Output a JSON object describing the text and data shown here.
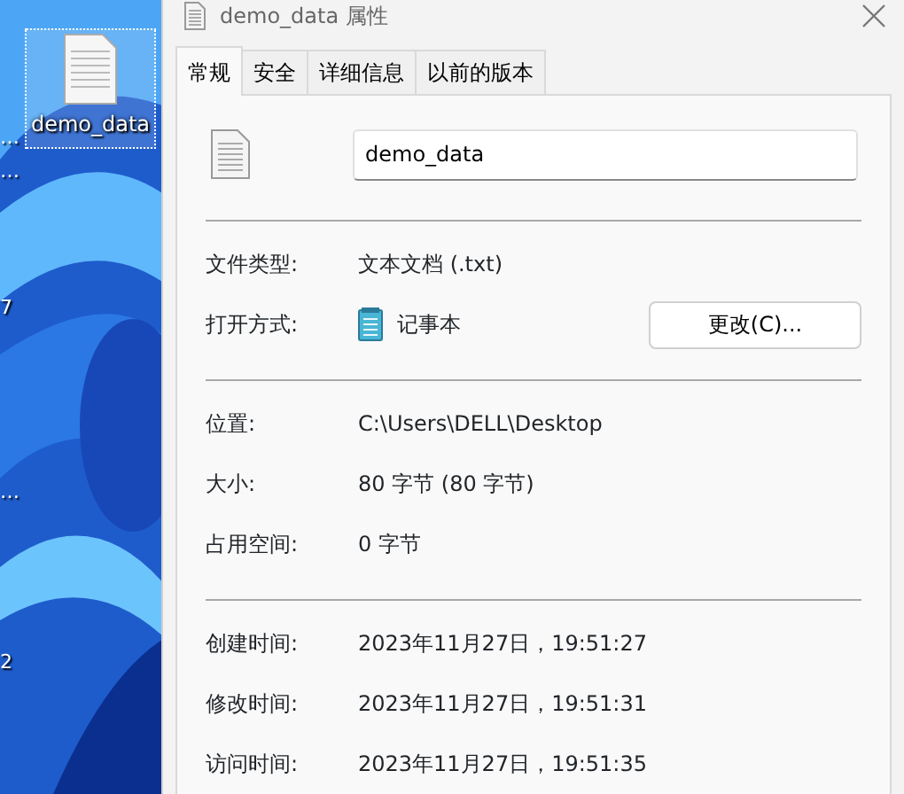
{
  "desktop": {
    "icons": [
      {
        "label": "demo_data",
        "selected": true
      }
    ],
    "cut_labels": [
      {
        "text": "…"
      },
      {
        "text": "…"
      },
      {
        "text": "7"
      },
      {
        "text": "…"
      },
      {
        "text": "2"
      }
    ]
  },
  "window": {
    "title": "demo_data 属性"
  },
  "tabs": [
    {
      "label": "常规",
      "selected": true
    },
    {
      "label": "安全",
      "selected": false
    },
    {
      "label": "详细信息",
      "selected": false
    },
    {
      "label": "以前的版本",
      "selected": false
    }
  ],
  "name_field": {
    "value": "demo_data"
  },
  "sections": [
    [
      {
        "label": "文件类型:",
        "value": "文本文档 (.txt)"
      },
      {
        "label": "打开方式:",
        "value": "记事本",
        "app_icon": true,
        "button": "更改(C)..."
      }
    ],
    [
      {
        "label": "位置:",
        "value": "C:\\Users\\DELL\\Desktop"
      },
      {
        "label": "大小:",
        "value": "80 字节 (80 字节)"
      },
      {
        "label": "占用空间:",
        "value": "0 字节"
      }
    ],
    [
      {
        "label": "创建时间:",
        "value": "2023年11月27日，19:51:27"
      },
      {
        "label": "修改时间:",
        "value": "2023年11月27日，19:51:31"
      },
      {
        "label": "访问时间:",
        "value": "2023年11月27日，19:51:35"
      }
    ]
  ]
}
